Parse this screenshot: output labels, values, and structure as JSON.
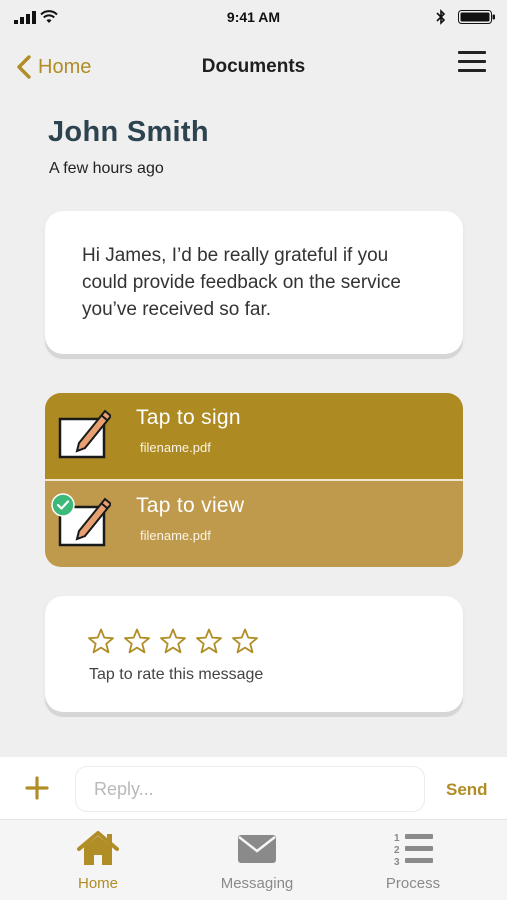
{
  "status_bar": {
    "time": "9:41 AM"
  },
  "nav": {
    "back_label": "Home",
    "title": "Documents"
  },
  "message": {
    "sender": "John Smith",
    "timestamp": "A few hours ago",
    "body": "Hi James, I’d be really grateful if you could provide feedback on the service you’ve received so far."
  },
  "documents": [
    {
      "action": "Tap to sign",
      "filename": "filename.pdf",
      "status": "pending"
    },
    {
      "action": "Tap to view",
      "filename": "filename.pdf",
      "status": "signed"
    }
  ],
  "rating": {
    "label": "Tap to rate this message",
    "stars_total": 5,
    "stars_filled": 0
  },
  "reply": {
    "placeholder": "Reply...",
    "send_label": "Send"
  },
  "tabs": [
    {
      "label": "Home",
      "icon": "house-icon",
      "active": true
    },
    {
      "label": "Messaging",
      "icon": "envelope-icon",
      "active": false
    },
    {
      "label": "Process",
      "icon": "numbered-list-icon",
      "active": false
    }
  ],
  "colors": {
    "accent": "#b08d25",
    "doc_sign_bg": "#ad8a22",
    "doc_view_bg": "#c09a4c",
    "check_green": "#3cb878",
    "name_color": "#2d4450",
    "background": "#efefef"
  }
}
